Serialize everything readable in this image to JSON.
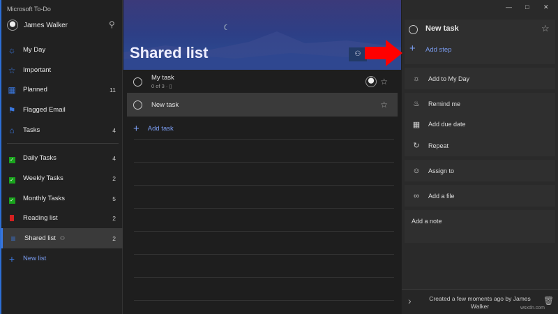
{
  "app_title": "Microsoft To-Do",
  "user": {
    "name": "James Walker"
  },
  "sidebar": {
    "items": [
      {
        "label": "My Day",
        "count": ""
      },
      {
        "label": "Important",
        "count": ""
      },
      {
        "label": "Planned",
        "count": "11"
      },
      {
        "label": "Flagged Email",
        "count": ""
      },
      {
        "label": "Tasks",
        "count": "4"
      }
    ],
    "lists": [
      {
        "label": "Daily Tasks",
        "count": "4"
      },
      {
        "label": "Weekly Tasks",
        "count": "2"
      },
      {
        "label": "Monthly Tasks",
        "count": "5"
      },
      {
        "label": "Reading list",
        "count": "2"
      },
      {
        "label": "Shared list",
        "count": "2"
      }
    ],
    "new_list": "New list"
  },
  "main": {
    "title": "Shared list",
    "tasks": [
      {
        "title": "My task",
        "meta": "0 of 3"
      },
      {
        "title": "New task"
      }
    ],
    "add_task": "Add task"
  },
  "detail": {
    "task_title": "New task",
    "add_step": "Add step",
    "add_to_my_day": "Add to My Day",
    "remind_me": "Remind me",
    "add_due_date": "Add due date",
    "repeat": "Repeat",
    "assign_to": "Assign to",
    "add_file": "Add a file",
    "add_note": "Add a note",
    "footer": "Created a few moments ago by James Walker"
  },
  "watermark": "wsxdn.com",
  "colors": {
    "accent": "#3a78e0",
    "arrow": "#ff0000"
  }
}
